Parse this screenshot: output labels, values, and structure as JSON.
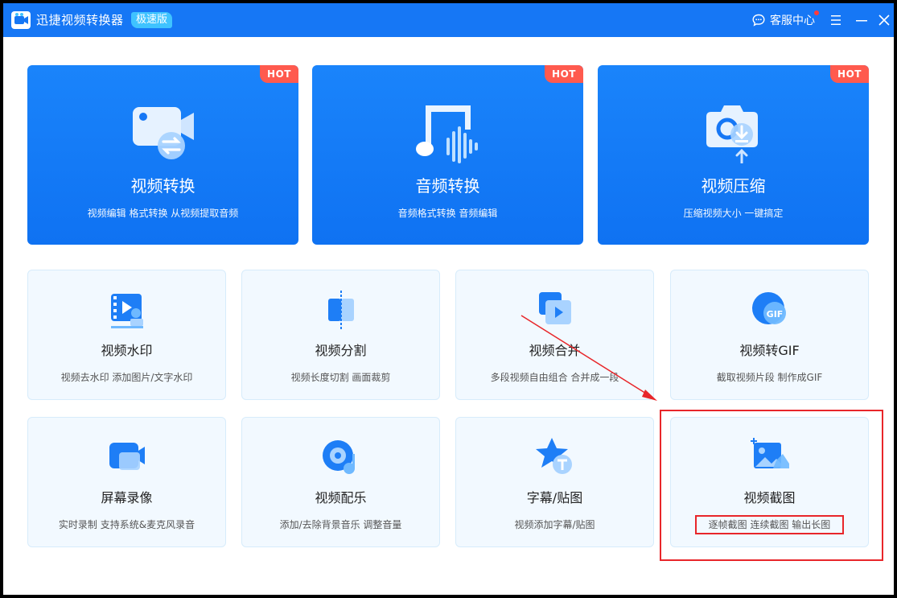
{
  "window": {
    "title": "迅捷视频转换器",
    "badge": "极速版",
    "support_label": "客服中心"
  },
  "icons": {
    "app": "video-converter-app-icon",
    "support": "chat-bubble-icon",
    "menu": "hamburger-menu-icon",
    "minimize": "minimize-icon",
    "close": "close-icon"
  },
  "colors": {
    "titlebar": "#1677f5",
    "primary_card": "#1a84fb",
    "hot_badge": "#ff5a4e",
    "tool_card_bg": "#f2f9ff",
    "annotation": "#e8262a"
  },
  "features": [
    {
      "title": "视频转换",
      "desc": "视频编辑 格式转换 从视频提取音频",
      "badge": "HOT",
      "icon": "video-convert-icon"
    },
    {
      "title": "音频转换",
      "desc": "音频格式转换 音频编辑",
      "badge": "HOT",
      "icon": "audio-wave-icon"
    },
    {
      "title": "视频压缩",
      "desc": "压缩视频大小 一键搞定",
      "badge": "HOT",
      "icon": "video-compress-icon"
    }
  ],
  "tools": [
    {
      "title": "视频水印",
      "desc": "视频去水印 添加图片/文字水印",
      "icon": "watermark-icon"
    },
    {
      "title": "视频分割",
      "desc": "视频长度切割 画面裁剪",
      "icon": "video-split-icon"
    },
    {
      "title": "视频合并",
      "desc": "多段视频自由组合 合并成一段",
      "icon": "video-merge-icon"
    },
    {
      "title": "视频转GIF",
      "desc": "截取视频片段 制作成GIF",
      "icon": "gif-icon"
    },
    {
      "title": "屏幕录像",
      "desc": "实时录制 支持系统&麦克风录音",
      "icon": "screen-record-icon"
    },
    {
      "title": "视频配乐",
      "desc": "添加/去除背景音乐 调整音量",
      "icon": "music-disc-icon"
    },
    {
      "title": "字幕/贴图",
      "desc": "视频添加字幕/贴图",
      "icon": "subtitle-star-icon"
    },
    {
      "title": "视频截图",
      "desc": "逐帧截图 连续截图 输出长图",
      "icon": "screenshot-image-icon"
    }
  ]
}
